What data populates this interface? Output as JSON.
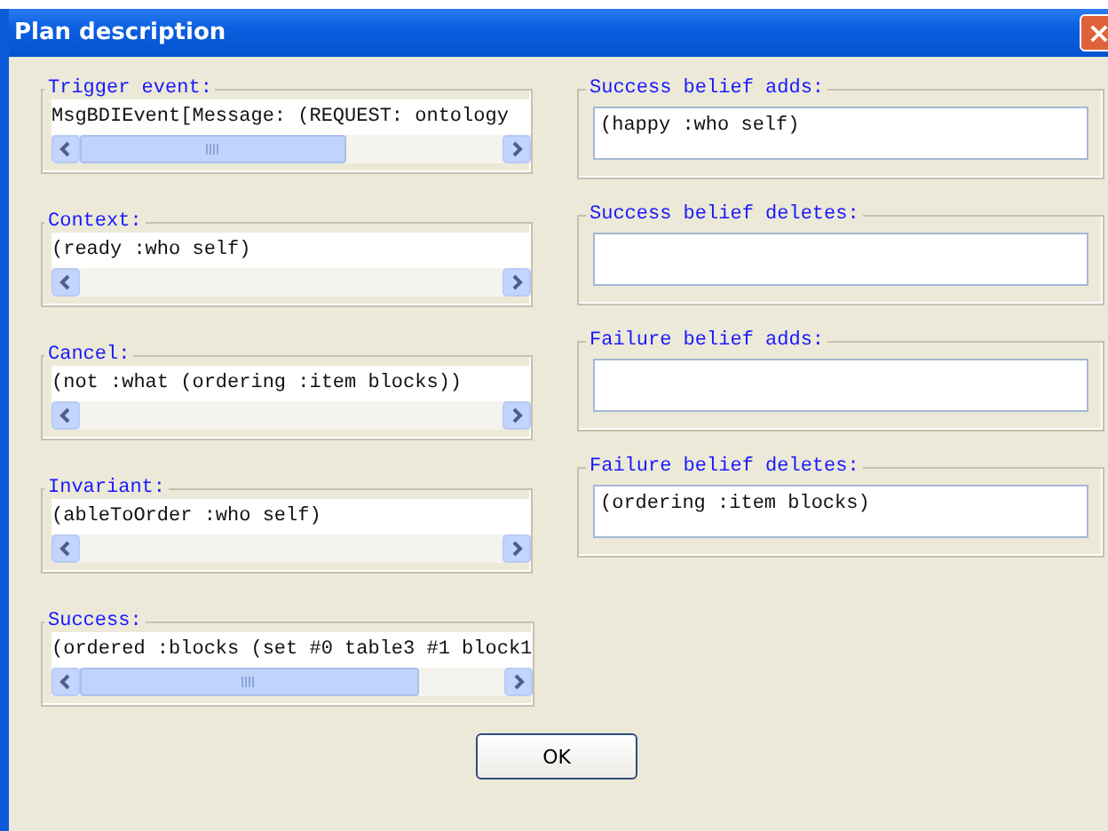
{
  "window": {
    "title": "Plan description",
    "close": "×"
  },
  "left_fields": [
    {
      "label": "Trigger event:",
      "value": "MsgBDIEvent[Message: (REQUEST: ontology",
      "overflow": true
    },
    {
      "label": "Context:",
      "value": "(ready :who self)",
      "overflow": false
    },
    {
      "label": "Cancel:",
      "value": "(not :what (ordering :item blocks))",
      "overflow": false
    },
    {
      "label": "Invariant:",
      "value": "(ableToOrder :who self)",
      "overflow": false
    },
    {
      "label": "Success:",
      "value": "(ordered :blocks (set #0 table3 #1 block1",
      "overflow": true
    }
  ],
  "right_fields": [
    {
      "label": "Success belief adds:",
      "value": "(happy :who self)"
    },
    {
      "label": "Success belief deletes:"
    },
    {
      "label": "Failure belief adds:"
    },
    {
      "label": "Failure belief deletes:",
      "value": "(ordering :item blocks)"
    }
  ],
  "buttons": [
    "OK"
  ]
}
